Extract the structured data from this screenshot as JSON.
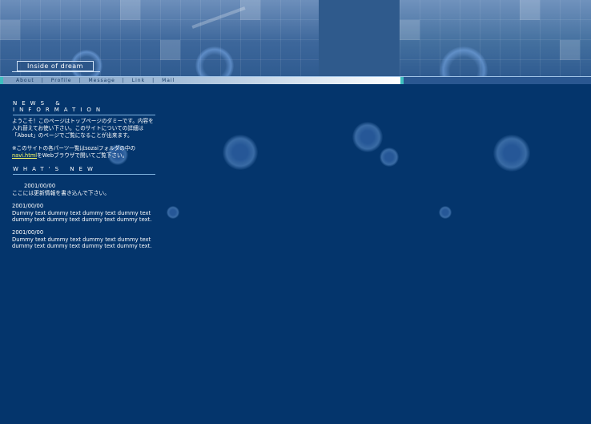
{
  "site": {
    "logo_text": "Inside of dream"
  },
  "nav": {
    "items": [
      "About",
      "Profile",
      "Message",
      "Link",
      "Mail"
    ],
    "separator": "|"
  },
  "news": {
    "title": "NEWS & INFORMATION",
    "line1": "ようこそ！このページはトップページのダミーです。内容を",
    "line2": "入れ替えてお使い下さい。このサイトについての詳細は",
    "line3": "「About」のページでご覧になることが出来ます。",
    "note1": "※このサイトの各パーツ一覧はsozaiフォルダの中の",
    "note_link": "navi.html",
    "note2": "をWebブラウザで開いてご覧下さい。"
  },
  "whats_new": {
    "title": "WHAT'S NEW",
    "entries": [
      {
        "date": "2001/00/00",
        "text1": "ここには更新情報を書き込んで下さい。",
        "text2": ""
      },
      {
        "date": "2001/00/00",
        "text1": "Dummy text dummy text dummy text dummy text",
        "text2": "dummy text dummy text dummy text dummy text."
      },
      {
        "date": "2001/00/00",
        "text1": "Dummy text dummy text dummy text dummy text",
        "text2": "dummy text dummy text dummy text dummy text."
      }
    ]
  },
  "colors": {
    "background": "#04356c",
    "header": "#2c5a8e",
    "accent": "#3fbfbf",
    "link": "#ffff66"
  }
}
